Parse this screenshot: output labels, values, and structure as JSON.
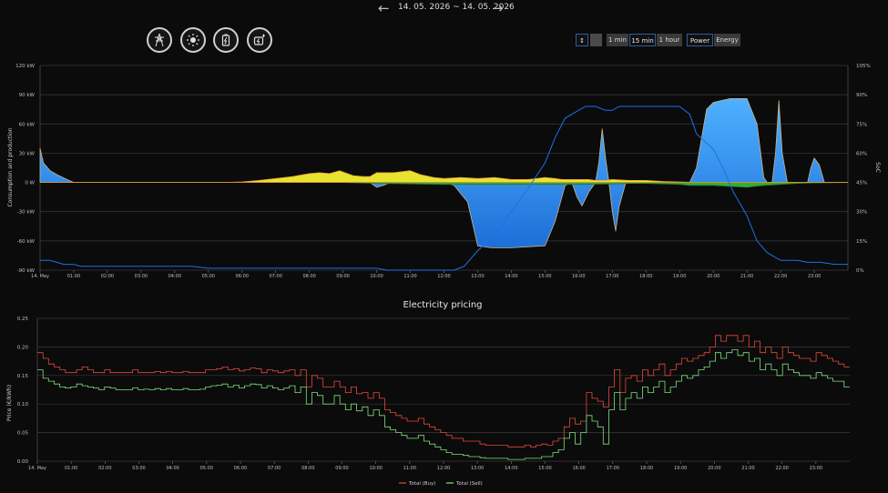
{
  "header": {
    "date_range": "14. 05. 2026 ~ 14. 05. 2026"
  },
  "icons": [
    "grid-icon",
    "sun-icon",
    "battery-icon",
    "ev-charger-icon"
  ],
  "controls": {
    "res_1min": "1 min",
    "res_15min": "15 min",
    "res_1hour": "1 hour",
    "power": "Power",
    "energy": "Energy"
  },
  "colors": {
    "battery": "#3a95f2",
    "soc": "#1f6fe8",
    "solar": "#e8e32e",
    "consumption": "#2fae3c",
    "buy": "#e5483c",
    "sell": "#7fe07f"
  },
  "chart_data": [
    {
      "type": "area",
      "title": "",
      "ylabel": "Consumption and production",
      "y2label": "SoC",
      "ylim": [
        -90,
        120
      ],
      "y2lim": [
        0,
        105
      ],
      "yticks": [
        "120 kW",
        "90 kW",
        "60 kW",
        "30 kW",
        "0 W",
        "-30 kW",
        "-60 kW",
        "-90 kW"
      ],
      "y2ticks": [
        "105%",
        "90%",
        "75%",
        "60%",
        "45%",
        "30%",
        "15%",
        "0%"
      ],
      "xticks": [
        "14. May",
        "01:00",
        "02:00",
        "03:00",
        "04:00",
        "05:00",
        "06:00",
        "07:00",
        "08:00",
        "09:00",
        "10:00",
        "11:00",
        "12:00",
        "13:00",
        "14:00",
        "15:00",
        "16:00",
        "17:00",
        "18:00",
        "19:00",
        "20:00",
        "21:00",
        "22:00",
        "23:00"
      ],
      "series": [
        {
          "key": "battery",
          "x": [
            0,
            0.1,
            0.3,
            0.5,
            0.8,
            1,
            8,
            9.8,
            10,
            10.2,
            10.4,
            11,
            12,
            12.3,
            12.7,
            13,
            13.4,
            14,
            15,
            15.3,
            15.6,
            15.8,
            15.95,
            16.1,
            16.3,
            16.5,
            16.6,
            16.7,
            16.8,
            16.9,
            17,
            17.1,
            17.2,
            17.4,
            17.6,
            18,
            19,
            19.3,
            19.5,
            19.8,
            20,
            20.5,
            21,
            21.3,
            21.5,
            21.6,
            21.75,
            21.85,
            21.95,
            22.05,
            22.2,
            22.8,
            22.9,
            23,
            23.15,
            23.3,
            23.6,
            24
          ],
          "y": [
            35,
            20,
            12,
            8,
            3,
            0,
            0,
            0,
            -5,
            -3,
            0,
            0,
            0,
            -3,
            -20,
            -65,
            -67,
            -67,
            -65,
            -40,
            -3,
            0,
            -15,
            -24,
            -10,
            0,
            20,
            55,
            25,
            0,
            -30,
            -50,
            -25,
            0,
            0,
            0,
            0,
            0,
            15,
            75,
            82,
            86,
            86,
            60,
            5,
            0,
            0,
            30,
            84,
            30,
            0,
            0,
            15,
            25,
            18,
            0,
            0,
            0
          ]
        },
        {
          "key": "solar",
          "x": [
            0,
            5.5,
            6,
            6.5,
            7,
            7.5,
            8,
            8.3,
            8.6,
            8.9,
            9.3,
            9.6,
            9.8,
            10,
            10.5,
            11,
            11.3,
            11.7,
            12,
            12.5,
            13,
            13.5,
            14,
            14.5,
            15,
            15.3,
            15.5,
            16,
            16.3,
            16.5,
            16.8,
            17,
            17.5,
            18,
            18.5,
            19,
            19.5,
            20,
            24
          ],
          "y": [
            0,
            0,
            0.5,
            2,
            4,
            6,
            9,
            10,
            9,
            12,
            7,
            6,
            6,
            10,
            10,
            12,
            8,
            5,
            4,
            5,
            4,
            5,
            3,
            3,
            5,
            4,
            3,
            3,
            3,
            2,
            2,
            3,
            2,
            2,
            1,
            0.5,
            0,
            0,
            0
          ]
        },
        {
          "key": "consumption",
          "x": [
            0,
            9,
            9.5,
            10,
            12,
            12.5,
            13,
            14,
            15,
            16,
            17,
            17.5,
            18,
            19,
            19.3,
            19.6,
            20,
            20.5,
            21,
            21.5,
            22,
            22.5,
            23,
            24
          ],
          "y": [
            0,
            0,
            -0.5,
            -1,
            -2,
            -2,
            -2,
            -2,
            -2,
            -2,
            -1.5,
            -1,
            -1,
            -2,
            -3,
            -3,
            -3,
            -4,
            -5,
            -3,
            -2,
            -1,
            -0.5,
            0
          ]
        }
      ],
      "soc": {
        "name": "SoC",
        "x": [
          0,
          0.3,
          0.5,
          0.7,
          1,
          1.2,
          2,
          3,
          4,
          4.5,
          5,
          6,
          7,
          8,
          9,
          10,
          10.3,
          10.6,
          11,
          11.5,
          12,
          12.3,
          12.6,
          13,
          13.5,
          14,
          14.5,
          15,
          15.3,
          15.6,
          16,
          16.2,
          16.5,
          16.8,
          17,
          17.2,
          17.5,
          18,
          19,
          19.3,
          19.5,
          20,
          20.3,
          20.6,
          21,
          21.3,
          21.6,
          22,
          22.5,
          22.8,
          23,
          23.2,
          23.6,
          24
        ],
        "y": [
          5,
          5,
          4,
          3,
          3,
          2,
          2,
          2,
          2,
          2,
          1,
          1,
          1,
          1,
          1,
          1,
          0,
          0,
          0,
          0,
          0,
          0,
          2,
          10,
          18,
          30,
          42,
          55,
          68,
          78,
          82,
          84,
          84,
          82,
          82,
          84,
          84,
          84,
          84,
          80,
          70,
          62,
          52,
          40,
          28,
          15,
          9,
          5,
          5,
          4,
          4,
          4,
          3,
          3
        ]
      }
    },
    {
      "type": "line",
      "title": "Electricity pricing",
      "ylabel": "Price (€/kWh)",
      "ylim": [
        0,
        0.25
      ],
      "yticks": [
        "0.25",
        "0.20",
        "0.15",
        "0.10",
        "0.05",
        "0.00"
      ],
      "xticks": [
        "14. May",
        "01:00",
        "02:00",
        "03:00",
        "04:00",
        "05:00",
        "06:00",
        "07:00",
        "08:00",
        "09:00",
        "10:00",
        "11:00",
        "12:00",
        "13:00",
        "14:00",
        "15:00",
        "16:00",
        "17:00",
        "18:00",
        "19:00",
        "20:00",
        "21:00",
        "22:00",
        "23:00"
      ],
      "series": [
        {
          "name": "Total (Buy)",
          "key": "buy",
          "values": [
            0.19,
            0.18,
            0.17,
            0.165,
            0.16,
            0.155,
            0.155,
            0.16,
            0.165,
            0.16,
            0.155,
            0.155,
            0.16,
            0.155,
            0.155,
            0.155,
            0.155,
            0.16,
            0.155,
            0.155,
            0.155,
            0.157,
            0.155,
            0.157,
            0.155,
            0.155,
            0.157,
            0.155,
            0.155,
            0.155,
            0.16,
            0.16,
            0.162,
            0.165,
            0.16,
            0.162,
            0.158,
            0.16,
            0.163,
            0.162,
            0.155,
            0.16,
            0.158,
            0.155,
            0.158,
            0.16,
            0.15,
            0.16,
            0.13,
            0.15,
            0.145,
            0.13,
            0.13,
            0.14,
            0.13,
            0.12,
            0.13,
            0.118,
            0.12,
            0.11,
            0.12,
            0.11,
            0.09,
            0.085,
            0.08,
            0.075,
            0.07,
            0.07,
            0.075,
            0.065,
            0.06,
            0.055,
            0.05,
            0.045,
            0.04,
            0.04,
            0.035,
            0.035,
            0.035,
            0.03,
            0.028,
            0.028,
            0.028,
            0.028,
            0.025,
            0.025,
            0.025,
            0.028,
            0.025,
            0.028,
            0.03,
            0.028,
            0.035,
            0.04,
            0.06,
            0.075,
            0.065,
            0.07,
            0.12,
            0.11,
            0.105,
            0.095,
            0.13,
            0.16,
            0.12,
            0.145,
            0.15,
            0.14,
            0.16,
            0.15,
            0.16,
            0.17,
            0.15,
            0.16,
            0.17,
            0.18,
            0.175,
            0.18,
            0.185,
            0.19,
            0.2,
            0.22,
            0.21,
            0.22,
            0.22,
            0.21,
            0.22,
            0.2,
            0.21,
            0.19,
            0.2,
            0.19,
            0.18,
            0.2,
            0.19,
            0.185,
            0.18,
            0.18,
            0.175,
            0.19,
            0.185,
            0.18,
            0.175,
            0.17,
            0.165
          ]
        },
        {
          "name": "Total (Sell)",
          "key": "sell",
          "values": [
            0.16,
            0.145,
            0.14,
            0.135,
            0.13,
            0.128,
            0.13,
            0.135,
            0.132,
            0.13,
            0.128,
            0.125,
            0.13,
            0.128,
            0.125,
            0.125,
            0.125,
            0.128,
            0.125,
            0.126,
            0.125,
            0.127,
            0.125,
            0.127,
            0.125,
            0.125,
            0.127,
            0.125,
            0.125,
            0.126,
            0.13,
            0.132,
            0.133,
            0.135,
            0.13,
            0.133,
            0.128,
            0.132,
            0.135,
            0.134,
            0.128,
            0.132,
            0.128,
            0.125,
            0.128,
            0.132,
            0.12,
            0.13,
            0.1,
            0.12,
            0.115,
            0.1,
            0.1,
            0.115,
            0.1,
            0.09,
            0.1,
            0.088,
            0.095,
            0.08,
            0.09,
            0.08,
            0.06,
            0.055,
            0.05,
            0.045,
            0.04,
            0.04,
            0.045,
            0.035,
            0.03,
            0.025,
            0.02,
            0.015,
            0.012,
            0.012,
            0.01,
            0.008,
            0.008,
            0.006,
            0.005,
            0.005,
            0.005,
            0.005,
            0.003,
            0.003,
            0.003,
            0.005,
            0.005,
            0.005,
            0.008,
            0.008,
            0.015,
            0.02,
            0.04,
            0.05,
            0.03,
            0.05,
            0.08,
            0.07,
            0.06,
            0.03,
            0.09,
            0.12,
            0.09,
            0.11,
            0.12,
            0.11,
            0.13,
            0.12,
            0.13,
            0.14,
            0.12,
            0.13,
            0.14,
            0.15,
            0.145,
            0.15,
            0.16,
            0.165,
            0.175,
            0.19,
            0.18,
            0.19,
            0.195,
            0.185,
            0.19,
            0.175,
            0.18,
            0.16,
            0.17,
            0.16,
            0.15,
            0.17,
            0.16,
            0.155,
            0.15,
            0.15,
            0.145,
            0.155,
            0.15,
            0.145,
            0.14,
            0.14,
            0.13
          ]
        }
      ]
    }
  ]
}
